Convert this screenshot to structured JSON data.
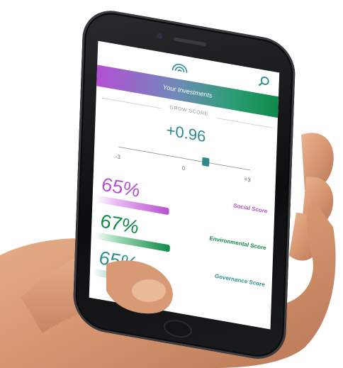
{
  "header": {
    "logo_icon": "rainbow-arc-logo",
    "search_icon": "search-icon"
  },
  "banner": {
    "title": "Your Investments"
  },
  "grow": {
    "section_label": "GROW SCORE",
    "score": "+0.96",
    "slider": {
      "min_label": "-3",
      "mid_label": "0",
      "max_label": "+3",
      "value": 0.96
    }
  },
  "metrics": [
    {
      "percent": "65%",
      "label": "Social Score",
      "value": 0.65,
      "color": "#b84fd1"
    },
    {
      "percent": "67%",
      "label": "Environmental Score",
      "value": 0.67,
      "color": "#0f8a45"
    },
    {
      "percent": "65%",
      "label": "Governance Score",
      "value": 0.65,
      "color": "#2b8f8f"
    }
  ],
  "colors": {
    "banner_start": "#b44fd3",
    "banner_end": "#0f8a4a",
    "accent": "#2f8a8d"
  }
}
